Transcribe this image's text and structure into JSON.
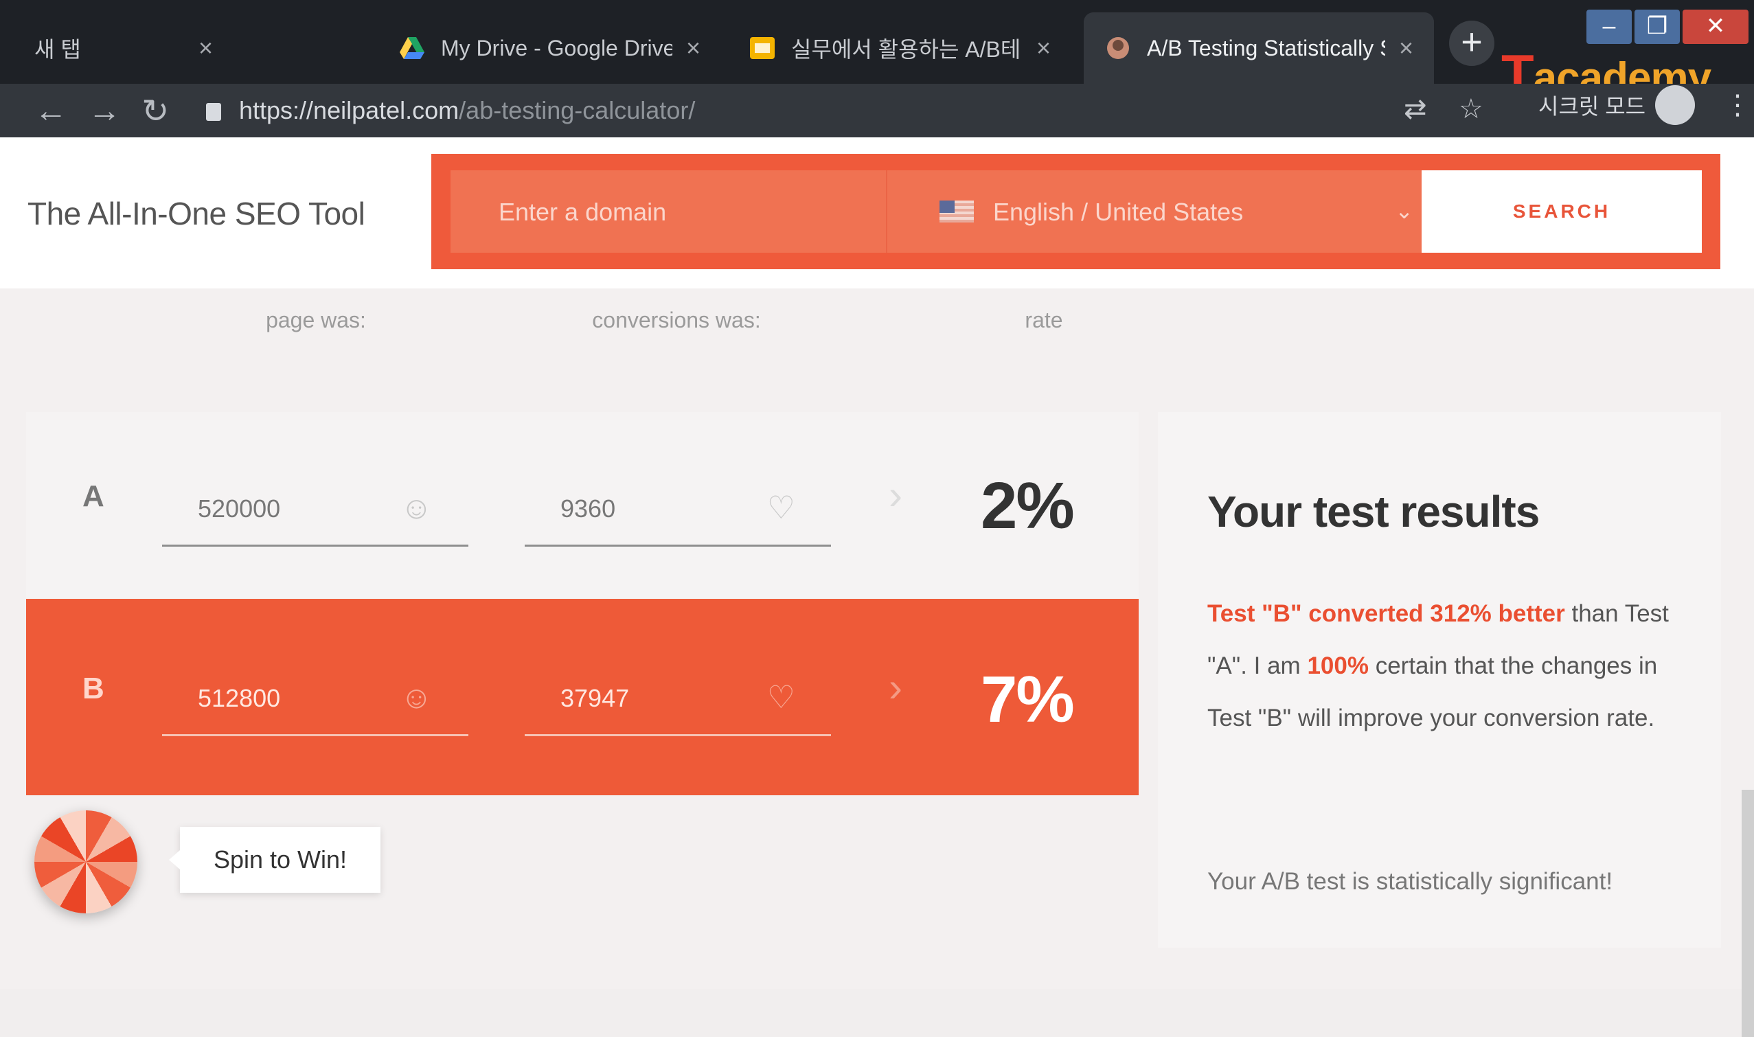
{
  "browser": {
    "tabs": [
      {
        "title": "새 탭",
        "active": false
      },
      {
        "title": "My Drive - Google Drive",
        "active": false
      },
      {
        "title": "실무에서 활용하는 A/B테",
        "active": false
      },
      {
        "title": "A/B Testing Statistically S",
        "active": true
      }
    ],
    "close_glyph": "×",
    "new_tab_glyph": "+",
    "url_domain": "https://neilpatel.com",
    "url_path": "/ab-testing-calculator/",
    "incognito_label": "시크릿 모드",
    "watermark_t": "T",
    "watermark_rest": "academy"
  },
  "header": {
    "brand_title": "The All-In-One SEO Tool",
    "domain_placeholder": "Enter a domain",
    "locale": "English / United States",
    "search_label": "SEARCH"
  },
  "calculator": {
    "column_labels": [
      "page was:",
      "conversions was:",
      "rate"
    ],
    "rows": [
      {
        "letter": "A",
        "visitors": "520000",
        "conversions": "9360",
        "rate": "2%"
      },
      {
        "letter": "B",
        "visitors": "512800",
        "conversions": "37947",
        "rate": "7%"
      }
    ]
  },
  "results": {
    "title": "Your test results",
    "highlight1": "Test \"B\" converted 312% better",
    "text1": " than Test \"A\". I am ",
    "highlight2": "100%",
    "text2": " certain that the changes in Test \"B\" will improve your conversion rate.",
    "significance": "Your A/B test is statistically significant!"
  },
  "spin": {
    "label": "Spin to Win!"
  },
  "colors": {
    "accent": "#ef5a3b",
    "chrome_dark": "#1e2126"
  }
}
